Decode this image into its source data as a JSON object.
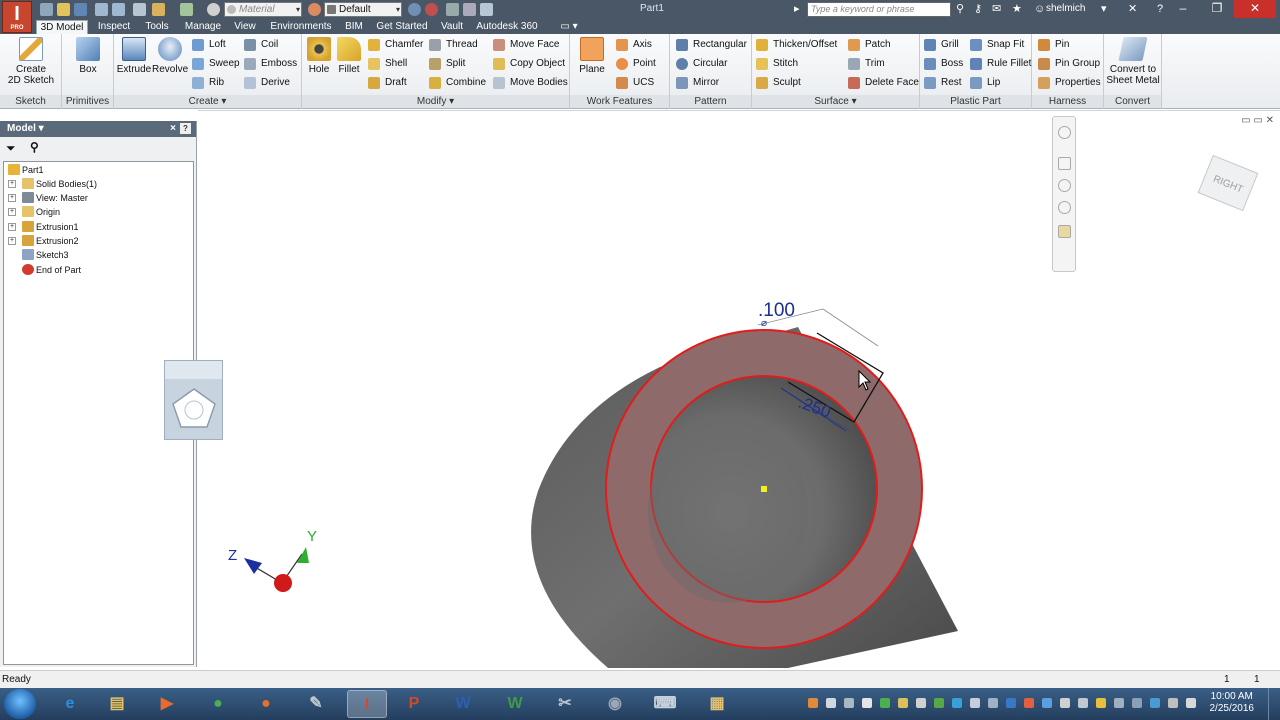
{
  "titlebar": {
    "material_placeholder": "Material",
    "appearance_value": "Default",
    "document_title": "Part1",
    "search_placeholder": "Type a keyword or phrase",
    "user_name": "shelmich",
    "app_logo_letter": "I",
    "app_logo_sub": "PRO"
  },
  "tabs": [
    "3D Model",
    "Inspect",
    "Tools",
    "Manage",
    "View",
    "Environments",
    "BIM",
    "Get Started",
    "Vault",
    "Autodesk 360"
  ],
  "ribbon": {
    "sketch": {
      "title": "Sketch",
      "create_sketch": "Create",
      "create_sketch2": "2D Sketch"
    },
    "primitives": {
      "title": "Primitives",
      "box": "Box"
    },
    "create": {
      "title": "Create ▾",
      "extrude": "Extrude",
      "revolve": "Revolve",
      "loft": "Loft",
      "sweep": "Sweep",
      "rib": "Rib",
      "coil": "Coil",
      "emboss": "Emboss",
      "derive": "Derive"
    },
    "modify": {
      "title": "Modify ▾",
      "hole": "Hole",
      "fillet": "Fillet",
      "chamfer": "Chamfer",
      "shell": "Shell",
      "draft": "Draft",
      "thread": "Thread",
      "split": "Split",
      "combine": "Combine",
      "move_face": "Move Face",
      "copy_object": "Copy Object",
      "move_bodies": "Move Bodies"
    },
    "work_features": {
      "title": "Work Features",
      "plane": "Plane",
      "axis": "Axis",
      "point": "Point",
      "ucs": "UCS"
    },
    "pattern": {
      "title": "Pattern",
      "rectangular": "Rectangular",
      "circular": "Circular",
      "mirror": "Mirror"
    },
    "surface": {
      "title": "Surface ▾",
      "thicken": "Thicken/Offset",
      "stitch": "Stitch",
      "sculpt": "Sculpt",
      "patch": "Patch",
      "trim": "Trim",
      "delete_face": "Delete Face"
    },
    "plastic_part": {
      "title": "Plastic Part",
      "grill": "Grill",
      "boss": "Boss",
      "rest": "Rest",
      "snap_fit": "Snap Fit",
      "rule_fillet": "Rule Fillet",
      "lip": "Lip"
    },
    "harness": {
      "title": "Harness",
      "pin": "Pin",
      "pin_group": "Pin Group",
      "properties": "Properties"
    },
    "convert": {
      "title": "Convert",
      "convert1": "Convert to",
      "convert2": "Sheet Metal"
    }
  },
  "browser": {
    "title": "Model ▾",
    "close": "×",
    "help": "?",
    "tree": [
      {
        "label": "Part1",
        "icon": "part-icon",
        "color": "#e8b437"
      },
      {
        "label": "Solid Bodies(1)",
        "icon": "folder-icon",
        "color": "#e6c36a"
      },
      {
        "label": "View: Master",
        "icon": "view-icon",
        "color": "#7e8a95"
      },
      {
        "label": "Origin",
        "icon": "folder-icon",
        "color": "#e6c36a"
      },
      {
        "label": "Extrusion1",
        "icon": "extrusion-icon",
        "color": "#d7a43a"
      },
      {
        "label": "Extrusion2",
        "icon": "extrusion-icon",
        "color": "#d7a43a"
      },
      {
        "label": "Sketch3",
        "icon": "sketch-icon",
        "color": "#8ea4c3"
      },
      {
        "label": "End of Part",
        "icon": "end-of-part-icon",
        "color": "#d33c2c"
      }
    ]
  },
  "viewport": {
    "dimension_thickness": ".100",
    "dimension_width": ".250",
    "viewcube_face": "RIGHT",
    "axis_z": "Z",
    "axis_y": "Y",
    "window_controls": "▭ ▭ ✕"
  },
  "status": {
    "text": "Ready",
    "count1": "1",
    "count2": "1"
  },
  "taskbar": {
    "time": "10:00 AM",
    "date": "2/25/2016",
    "apps": [
      {
        "name": "ie",
        "glyph": "e",
        "color": "#2a8ed8"
      },
      {
        "name": "file-explorer",
        "glyph": "▤",
        "color": "#e8c05c"
      },
      {
        "name": "media",
        "glyph": "▶",
        "color": "#e86a2c"
      },
      {
        "name": "chrome",
        "glyph": "●",
        "color": "#4caf50"
      },
      {
        "name": "firefox",
        "glyph": "●",
        "color": "#e8702c"
      },
      {
        "name": "tool",
        "glyph": "✎",
        "color": "#c0c8d0"
      },
      {
        "name": "inventor",
        "glyph": "I",
        "color": "#d2492f"
      },
      {
        "name": "powerpoint",
        "glyph": "P",
        "color": "#d04a2a"
      },
      {
        "name": "word",
        "glyph": "W",
        "color": "#2b5fb4"
      },
      {
        "name": "solidworks",
        "glyph": "W",
        "color": "#3f9b46"
      },
      {
        "name": "snipping",
        "glyph": "✂",
        "color": "#b8c4cf"
      },
      {
        "name": "camera",
        "glyph": "◉",
        "color": "#9aa7b5"
      },
      {
        "name": "keyboard",
        "glyph": "⌨",
        "color": "#c9d3dd"
      },
      {
        "name": "clipboard",
        "glyph": "▦",
        "color": "#e0c070"
      }
    ]
  },
  "colors": {
    "accent_red": "#e31b1b",
    "face_fill": "#8e6a6a",
    "dimension_blue": "#1d2f8f"
  }
}
